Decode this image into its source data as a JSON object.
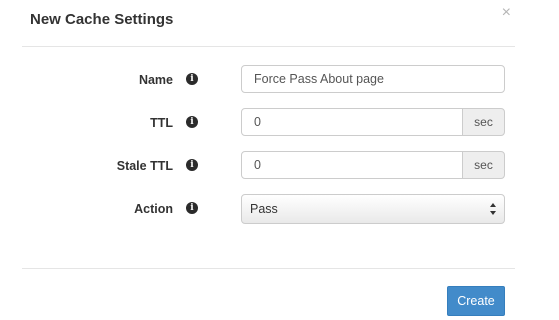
{
  "dialog": {
    "title": "New Cache Settings",
    "close_label": "×"
  },
  "form": {
    "name": {
      "label": "Name",
      "value": "Force Pass About page",
      "info_icon": "info-circle-icon"
    },
    "ttl": {
      "label": "TTL",
      "value": "0",
      "unit": "sec",
      "info_icon": "info-circle-icon"
    },
    "stale_ttl": {
      "label": "Stale TTL",
      "value": "0",
      "unit": "sec",
      "info_icon": "info-circle-icon"
    },
    "action": {
      "label": "Action",
      "selected": "Pass",
      "info_icon": "info-circle-icon"
    }
  },
  "footer": {
    "create_label": "Create"
  },
  "colors": {
    "primary": "#428bca",
    "icon": "#2b2b2b",
    "addon_bg": "#eeeeee"
  }
}
